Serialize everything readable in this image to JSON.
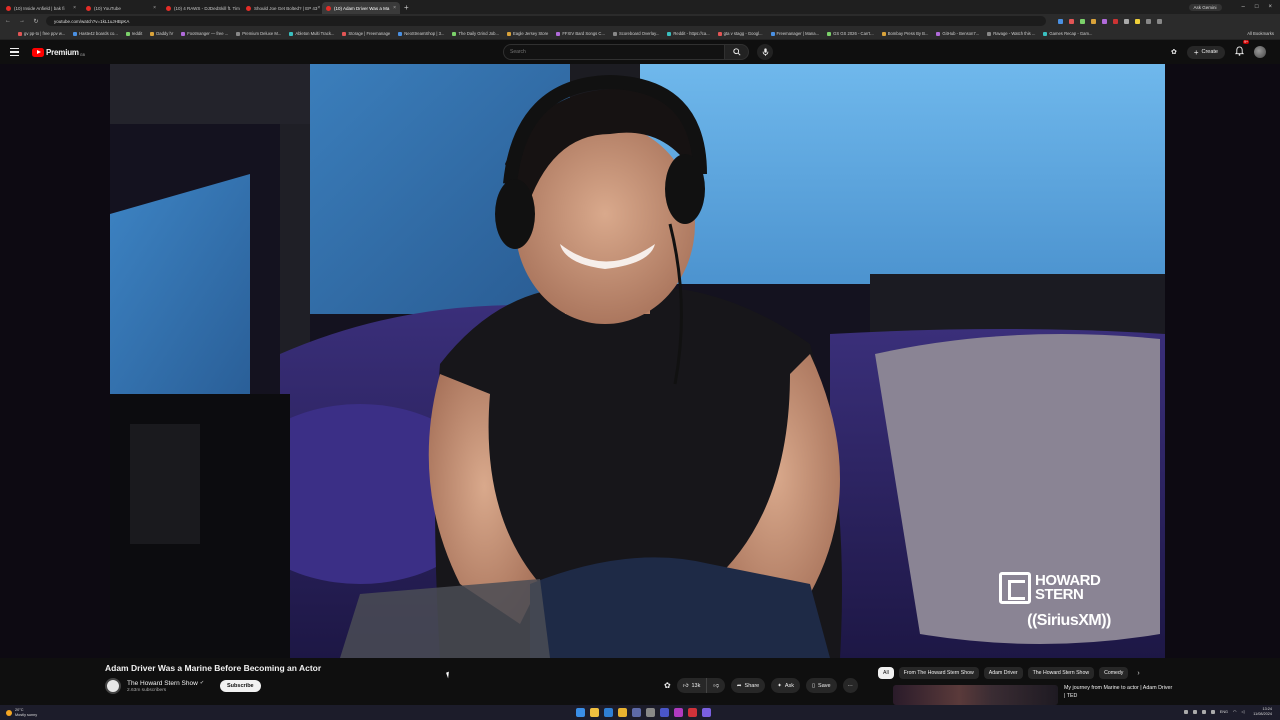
{
  "browser": {
    "tabs": [
      {
        "title": "(10) Inside Anfield | bak fi",
        "active": false
      },
      {
        "title": "(10) YouTube",
        "active": false
      },
      {
        "title": "(10) 4 RAWS - DJDedSkill ft. Tim",
        "active": false
      },
      {
        "title": "Should Joe Get Bolted? | EP 43",
        "active": false
      },
      {
        "title": "(10) Adam Driver Was a Ma",
        "active": true
      }
    ],
    "new_tab": "+",
    "ask_gemini": "Ask Gemini",
    "url": "youtube.com/watch?v=1kL1uJHBpKA",
    "bookmarks": [
      "gv pp-to | free ppv w...",
      "Haste42 boards co...",
      "reddit",
      "Daddy lV",
      "Footmanger — free ...",
      "Premium Deluxe M...",
      "Ableton Multi Track...",
      "Storage | Freemanage",
      "NeoStreamShop | 3...",
      "The Daily Grind Job...",
      "Eagle Jersey Store",
      "FFXIV Bard Songs C...",
      "Scoreboard Overlay...",
      "Reddit - https://ca...",
      "gta v stagg - Googl...",
      "Freemanager | Mana...",
      "GS GS 2026 - Can't...",
      "Bombay Press By B...",
      "GitHub - Benson7...",
      "Ravage - Watch this ...",
      "Games Recap - Gam..."
    ],
    "all_bookmarks": "All Bookmarks"
  },
  "youtube": {
    "logo_text": "Premium",
    "country_code": "GB",
    "search_placeholder": "Search",
    "create_label": "Create",
    "notification_count": "9+"
  },
  "video": {
    "title": "Adam Driver Was a Marine Before Becoming an Actor",
    "watermark_top": "HOWARD\nSTERN",
    "watermark_bottom": "((SiriusXM))"
  },
  "channel": {
    "name": "The Howard Stern Show",
    "subscribers": "2.63m subscribers",
    "subscribe_label": "Subscribe"
  },
  "actions": {
    "likes": "13k",
    "share": "Share",
    "ask": "Ask",
    "save": "Save",
    "more": "···"
  },
  "chips": [
    "All",
    "From The Howard Stern Show",
    "Adam Driver",
    "The Howard Stern Show",
    "Comedy"
  ],
  "recommended": {
    "title": "My journey from Marine to actor | Adam Driver | TED"
  },
  "taskbar": {
    "temp": "20°C",
    "weather": "Mostly sunny",
    "time": "13:24",
    "date": "11/08/2024",
    "lang": "ENG"
  }
}
